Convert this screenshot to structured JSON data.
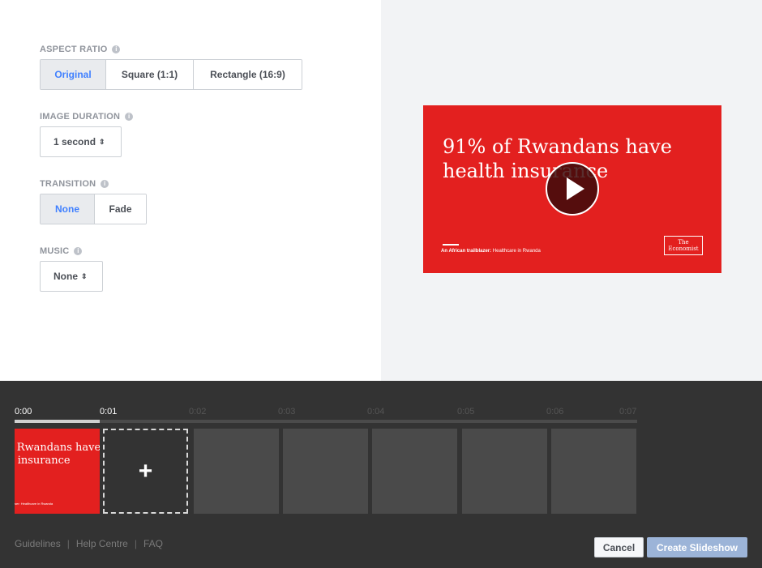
{
  "aspect_ratio": {
    "label": "ASPECT RATIO",
    "options": [
      "Original",
      "Square (1:1)",
      "Rectangle (16:9)"
    ],
    "selected": "Original"
  },
  "image_duration": {
    "label": "IMAGE DURATION",
    "value": "1 second"
  },
  "transition": {
    "label": "TRANSITION",
    "options": [
      "None",
      "Fade"
    ],
    "selected": "None"
  },
  "music": {
    "label": "MUSIC",
    "value": "None"
  },
  "preview": {
    "headline": "91% of Rwandans have health insurance",
    "caption_bold": "An African trailblazer:",
    "caption_rest": " Healthcare in Rwanda",
    "logo_line1": "The",
    "logo_line2": "Economist",
    "bg_color": "#e3201f"
  },
  "timeline": {
    "ticks": [
      "0:00",
      "0:01",
      "0:02",
      "0:03",
      "0:04",
      "0:05",
      "0:06",
      "0:07"
    ],
    "thumb_text": "of Rwandans have th insurance",
    "thumb_line1": "of Rwandans have",
    "thumb_line2": "th insurance",
    "thumb_caption": "ser: Healthcare in Rwanda",
    "progress_fraction": 0.137
  },
  "footer": {
    "links": [
      "Guidelines",
      "Help Centre",
      "FAQ"
    ],
    "cancel_label": "Cancel",
    "create_label": "Create Slideshow"
  }
}
